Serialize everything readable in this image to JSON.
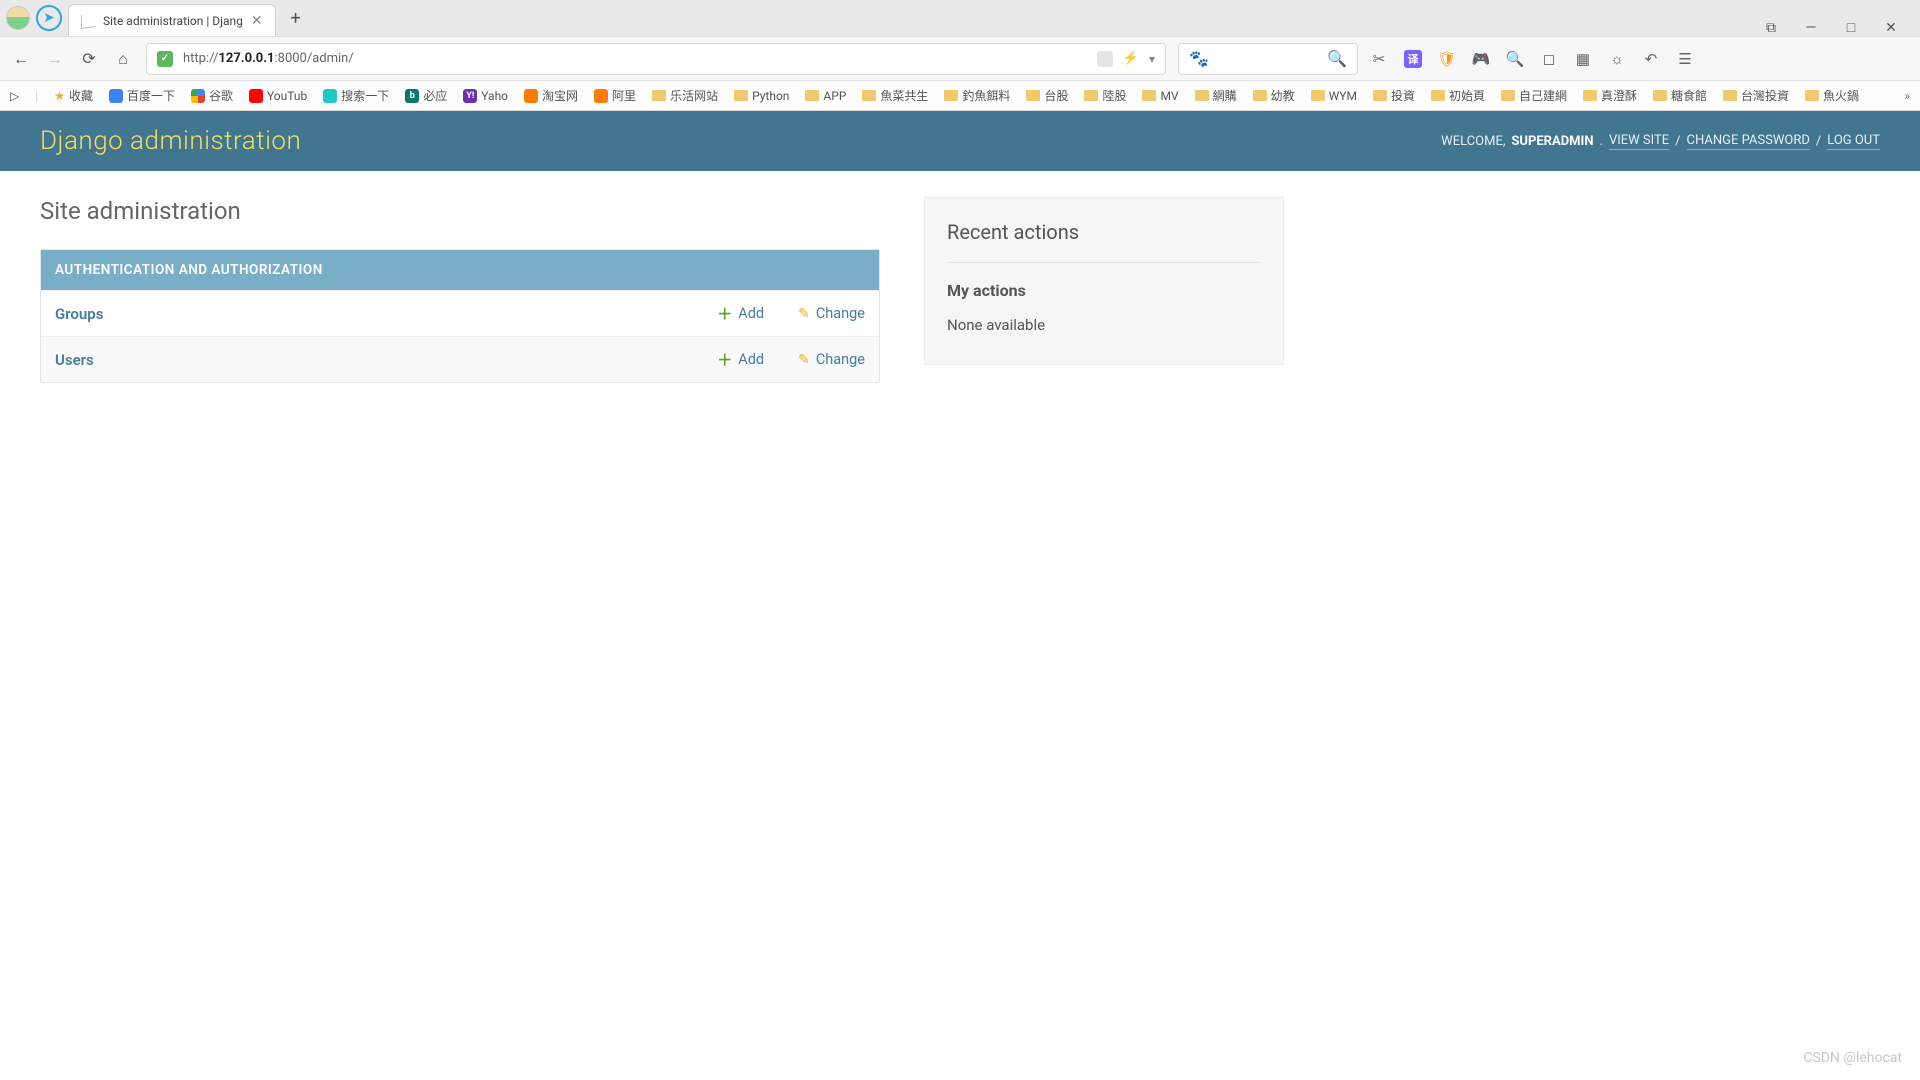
{
  "browser": {
    "tab_title": "Site administration | Djang",
    "url_host": "127.0.0.1",
    "url_prefix": "http://",
    "url_port_path": ":8000/admin/",
    "win_controls": {
      "pip": "⧉",
      "min": "—",
      "max": "□",
      "close": "✕"
    }
  },
  "bookmarks": [
    {
      "label": "收藏",
      "kind": "star"
    },
    {
      "label": "百度一下",
      "kind": "ico-blue"
    },
    {
      "label": "谷歌",
      "kind": "google"
    },
    {
      "label": "YouTub",
      "kind": "yt"
    },
    {
      "label": "搜索一下",
      "kind": "cyan"
    },
    {
      "label": "必应",
      "kind": "bing",
      "badge": "b"
    },
    {
      "label": "Yaho",
      "kind": "yahoo",
      "badge": "Y!"
    },
    {
      "label": "淘宝网",
      "kind": "orange"
    },
    {
      "label": "阿里",
      "kind": "orange"
    },
    {
      "label": "乐活网站",
      "kind": "folder"
    },
    {
      "label": "Python",
      "kind": "folder"
    },
    {
      "label": "APP",
      "kind": "folder"
    },
    {
      "label": "魚菜共生",
      "kind": "folder"
    },
    {
      "label": "釣魚餌料",
      "kind": "folder"
    },
    {
      "label": "台股",
      "kind": "folder"
    },
    {
      "label": "陸股",
      "kind": "folder"
    },
    {
      "label": "MV",
      "kind": "folder"
    },
    {
      "label": "網購",
      "kind": "folder"
    },
    {
      "label": "幼教",
      "kind": "folder"
    },
    {
      "label": "WYM",
      "kind": "folder"
    },
    {
      "label": "投資",
      "kind": "folder"
    },
    {
      "label": "初始頁",
      "kind": "folder"
    },
    {
      "label": "自己建網",
      "kind": "folder"
    },
    {
      "label": "真澄酥",
      "kind": "folder"
    },
    {
      "label": "糖食館",
      "kind": "folder"
    },
    {
      "label": "台灣投資",
      "kind": "folder"
    },
    {
      "label": "魚火鍋",
      "kind": "folder"
    }
  ],
  "django": {
    "brand": "Django administration",
    "welcome": "WELCOME,",
    "username": "SUPERADMIN",
    "links": {
      "view_site": "VIEW SITE",
      "change_password": "CHANGE PASSWORD",
      "log_out": "LOG OUT"
    },
    "page_title": "Site administration",
    "module": {
      "caption": "AUTHENTICATION AND AUTHORIZATION",
      "rows": [
        {
          "model": "Groups",
          "add": "Add",
          "change": "Change"
        },
        {
          "model": "Users",
          "add": "Add",
          "change": "Change"
        }
      ]
    },
    "recent": {
      "heading": "Recent actions",
      "sub": "My actions",
      "empty": "None available"
    }
  },
  "watermark": "CSDN @lehocat"
}
